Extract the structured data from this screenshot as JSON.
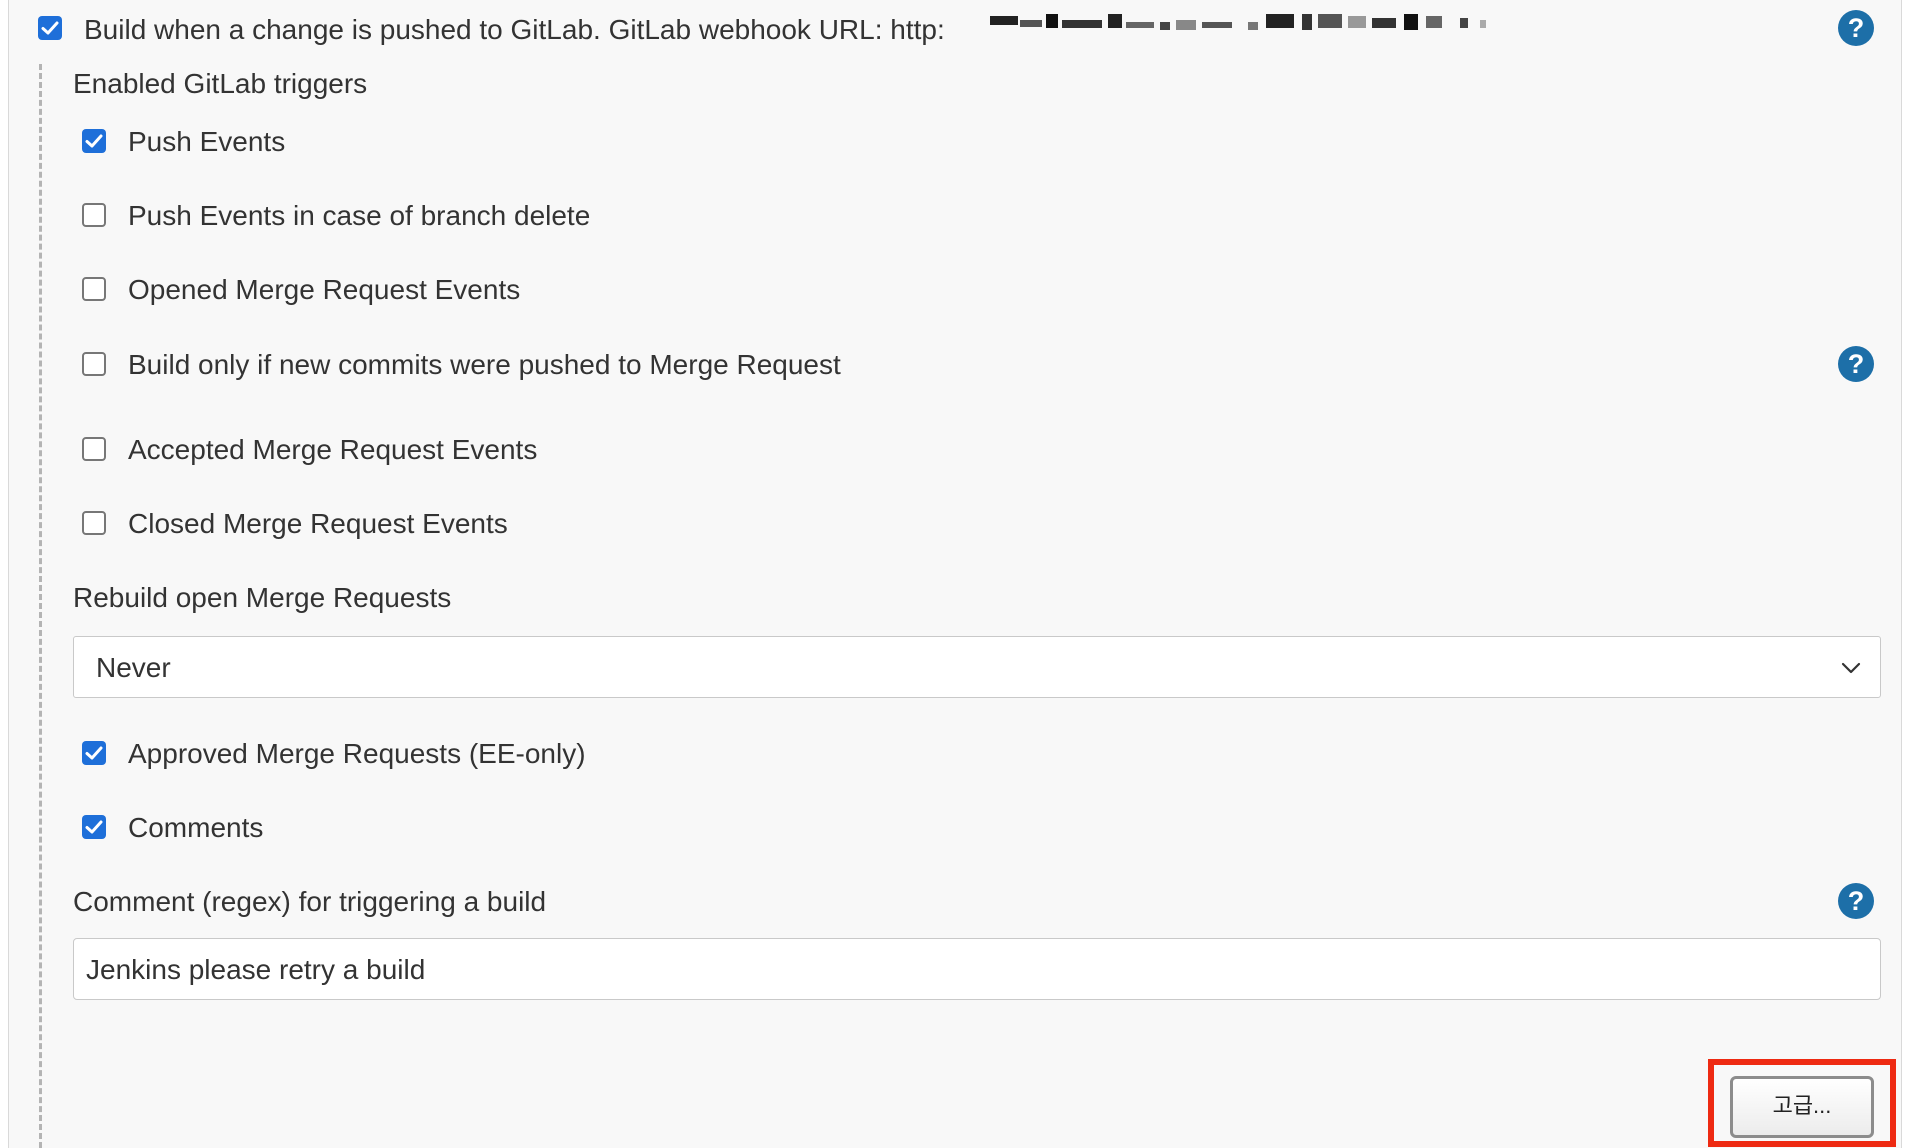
{
  "trigger": {
    "label": "Build when a change is pushed to GitLab. GitLab webhook URL: http:",
    "checked": true
  },
  "triggers_section": {
    "heading": "Enabled GitLab triggers",
    "items": [
      {
        "label": "Push Events",
        "checked": true
      },
      {
        "label": "Push Events in case of branch delete",
        "checked": false
      },
      {
        "label": "Opened Merge Request Events",
        "checked": false
      },
      {
        "label": "Build only if new commits were pushed to Merge Request",
        "checked": false
      },
      {
        "label": "Accepted Merge Request Events",
        "checked": false
      },
      {
        "label": "Closed Merge Request Events",
        "checked": false
      }
    ]
  },
  "rebuild": {
    "label": "Rebuild open Merge Requests",
    "selected": "Never"
  },
  "extra_items": [
    {
      "label": "Approved Merge Requests (EE-only)",
      "checked": true
    },
    {
      "label": "Comments",
      "checked": true
    }
  ],
  "comment_regex": {
    "label": "Comment (regex) for triggering a build",
    "value": "Jenkins please retry a build"
  },
  "help_symbol": "?",
  "advanced_button": {
    "label": "고급..."
  },
  "colors": {
    "checkbox_checked": "#1e6fd9",
    "help_icon": "#1d6fa8",
    "highlight_box": "#ee2a12"
  }
}
